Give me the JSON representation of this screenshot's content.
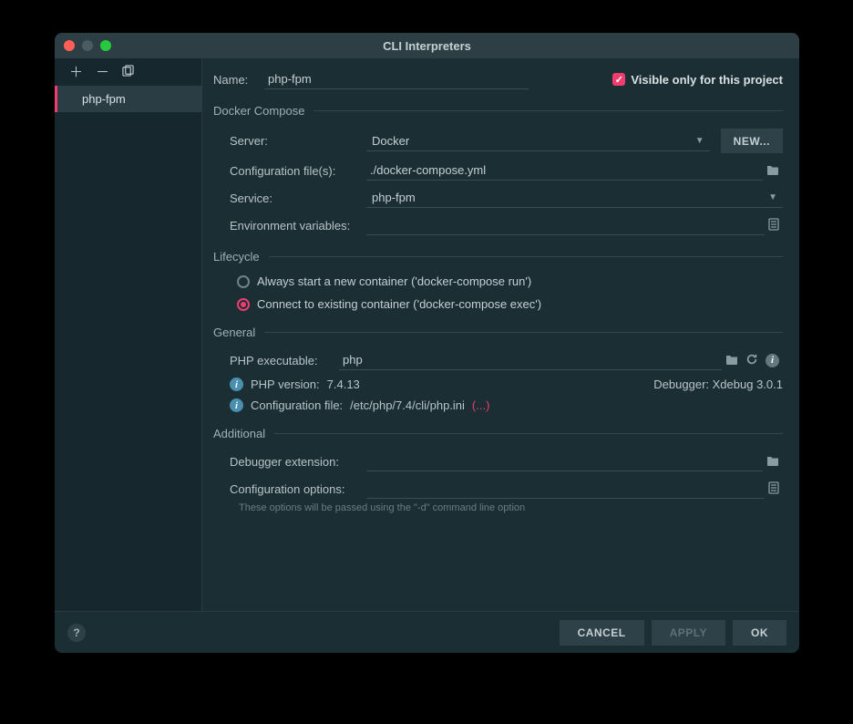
{
  "window": {
    "title": "CLI Interpreters"
  },
  "sidebar": {
    "items": [
      {
        "label": "php-fpm",
        "selected": true
      }
    ]
  },
  "form": {
    "name_label": "Name:",
    "name_value": "php-fpm",
    "visible_checkbox_label": "Visible only for this project",
    "visible_checked": true
  },
  "docker_compose": {
    "title": "Docker Compose",
    "server_label": "Server:",
    "server_value": "Docker",
    "new_button": "NEW...",
    "config_files_label": "Configuration file(s):",
    "config_files_value": "./docker-compose.yml",
    "service_label": "Service:",
    "service_value": "php-fpm",
    "env_label": "Environment variables:",
    "env_value": ""
  },
  "lifecycle": {
    "title": "Lifecycle",
    "option_new": "Always start a new container ('docker-compose run')",
    "option_exec": "Connect to existing container ('docker-compose exec')",
    "selected": "exec"
  },
  "general": {
    "title": "General",
    "php_exec_label": "PHP executable:",
    "php_exec_value": "php",
    "php_version_label": "PHP version:",
    "php_version_value": "7.4.13",
    "debugger_label": "Debugger:",
    "debugger_value": "Xdebug 3.0.1",
    "config_file_label": "Configuration file:",
    "config_file_value": "/etc/php/7.4/cli/php.ini",
    "config_file_more": "(...)"
  },
  "additional": {
    "title": "Additional",
    "debugger_ext_label": "Debugger extension:",
    "debugger_ext_value": "",
    "config_opts_label": "Configuration options:",
    "config_opts_value": "",
    "hint": "These options will be passed using the \"-d\" command line option"
  },
  "footer": {
    "cancel": "CANCEL",
    "apply": "APPLY",
    "ok": "OK"
  }
}
